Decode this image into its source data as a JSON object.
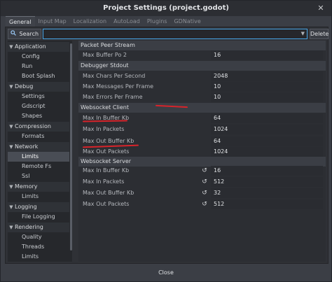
{
  "window": {
    "title": "Project Settings (project.godot)",
    "close_glyph": "✕"
  },
  "tabs": [
    {
      "label": "General",
      "active": true
    },
    {
      "label": "Input Map"
    },
    {
      "label": "Localization"
    },
    {
      "label": "AutoLoad"
    },
    {
      "label": "Plugins"
    },
    {
      "label": "GDNative"
    }
  ],
  "toolbar": {
    "search_label": "Search",
    "search_icon": "search-icon",
    "search_value": "",
    "delete_label": "Delete"
  },
  "tree": [
    {
      "label": "Application",
      "type": "category"
    },
    {
      "label": "Config",
      "type": "child"
    },
    {
      "label": "Run",
      "type": "child"
    },
    {
      "label": "Boot Splash",
      "type": "child"
    },
    {
      "label": "Debug",
      "type": "category"
    },
    {
      "label": "Settings",
      "type": "child"
    },
    {
      "label": "Gdscript",
      "type": "child"
    },
    {
      "label": "Shapes",
      "type": "child"
    },
    {
      "label": "Compression",
      "type": "category"
    },
    {
      "label": "Formats",
      "type": "child"
    },
    {
      "label": "Network",
      "type": "category"
    },
    {
      "label": "Limits",
      "type": "child",
      "selected": true
    },
    {
      "label": "Remote Fs",
      "type": "child"
    },
    {
      "label": "Ssl",
      "type": "child"
    },
    {
      "label": "Memory",
      "type": "category"
    },
    {
      "label": "Limits",
      "type": "child"
    },
    {
      "label": "Logging",
      "type": "category"
    },
    {
      "label": "File Logging",
      "type": "child"
    },
    {
      "label": "Rendering",
      "type": "category"
    },
    {
      "label": "Quality",
      "type": "child"
    },
    {
      "label": "Threads",
      "type": "child"
    },
    {
      "label": "Limits",
      "type": "child"
    }
  ],
  "properties": [
    {
      "section": "Packet Peer Stream"
    },
    {
      "label": "Max Buffer Po 2",
      "value": "16"
    },
    {
      "section": "Debugger Stdout"
    },
    {
      "label": "Max Chars Per Second",
      "value": "2048"
    },
    {
      "label": "Max Messages Per Frame",
      "value": "10"
    },
    {
      "label": "Max Errors Per Frame",
      "value": "10"
    },
    {
      "section": "Websocket Client"
    },
    {
      "label": "Max In Buffer Kb",
      "value": "64"
    },
    {
      "label": "Max In Packets",
      "value": "1024"
    },
    {
      "label": "Max Out Buffer Kb",
      "value": "64"
    },
    {
      "label": "Max Out Packets",
      "value": "1024"
    },
    {
      "section": "Websocket Server"
    },
    {
      "label": "Max In Buffer Kb",
      "value": "16",
      "revert": true
    },
    {
      "label": "Max In Packets",
      "value": "512",
      "revert": true
    },
    {
      "label": "Max Out Buffer Kb",
      "value": "32",
      "revert": true
    },
    {
      "label": "Max Out Packets",
      "value": "512",
      "revert": true
    }
  ],
  "footer": {
    "close_label": "Close"
  },
  "colors": {
    "annotation_red": "#d8232a",
    "accent": "#47a5e6"
  }
}
